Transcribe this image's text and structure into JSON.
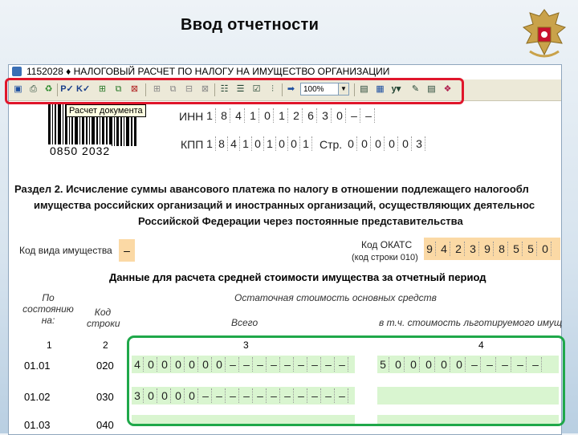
{
  "slide": {
    "title": "Ввод отчетности"
  },
  "window": {
    "title": "1152028 ♦ НАЛОГОВЫЙ РАСЧЕТ ПО НАЛОГУ НА ИМУЩЕСТВО ОРГАНИЗАЦИИ",
    "zoom": "100%"
  },
  "toolbar": {
    "tooltip": "Расчет документа",
    "icons": [
      "save-icon",
      "print-icon",
      "recycle-icon",
      "pv-icon",
      "kv-icon",
      "add-row-icon",
      "copy-row-icon",
      "delete-row-icon",
      "add-doc-icon",
      "copy-doc-icon",
      "edit-doc-icon",
      "delete-doc-icon",
      "calc-icon",
      "list-icon",
      "check-icon",
      "arrow-icon",
      "zoom-select",
      "layout-icon",
      "chart-icon",
      "y-icon",
      "tools-icon",
      "notes-icon",
      "book-icon"
    ]
  },
  "barcode": {
    "number": "0850 2032"
  },
  "header_form": {
    "inn_label": "ИНН",
    "inn_digits": [
      "1",
      "8",
      "4",
      "1",
      "0",
      "1",
      "2",
      "6",
      "3",
      "0",
      "–",
      "–"
    ],
    "kpp_label": "КПП",
    "kpp_digits": [
      "1",
      "8",
      "4",
      "1",
      "0",
      "1",
      "0",
      "0",
      "1"
    ],
    "page_label": "Стр.",
    "page_digits": [
      "0",
      "0",
      "0",
      "0",
      "0",
      "3"
    ]
  },
  "section": {
    "line1": "Раздел 2. Исчисление суммы авансового платежа по налогу в отношении подлежащего налогообл",
    "line2": "имущества российских организаций и иностранных организаций, осуществляющих деятельнос",
    "line3": "Российской Федерации через постоянные представительства"
  },
  "property": {
    "kind_label": "Код вида имущества",
    "kind_value": "–",
    "okato_label": "Код ОКАТС",
    "okato_sublabel": "(код строки 010)",
    "okato_digits": [
      "9",
      "4",
      "2",
      "3",
      "9",
      "8",
      "5",
      "5",
      "0"
    ]
  },
  "table": {
    "title": "Данные для расчета средней стоимости имущества за отчетный период",
    "col1_header": "По состоянию на:",
    "col2_header": "Код строки",
    "group_header": "Остаточная стоимость основных средств",
    "col3_header": "Всего",
    "col4_header": "в т.ч. стоимость льготируемого имущ",
    "col_numbers": [
      "1",
      "2",
      "3",
      "4"
    ],
    "rows": [
      {
        "date": "01.01",
        "code": "020",
        "total": [
          "4",
          "0",
          "0",
          "0",
          "0",
          "0",
          "0",
          "–",
          "–",
          "–",
          "–",
          "–",
          "–",
          "–",
          "–",
          "–"
        ],
        "benefit": [
          "5",
          "0",
          "0",
          "0",
          "0",
          "0",
          "–",
          "–",
          "–",
          "–",
          "–"
        ]
      },
      {
        "date": "01.02",
        "code": "030",
        "total": [
          "3",
          "0",
          "0",
          "0",
          "0",
          "–",
          "–",
          "–",
          "–",
          "–",
          "–",
          "–",
          "–",
          "–",
          "–",
          "–"
        ],
        "benefit": []
      },
      {
        "date": "01.03",
        "code": "040",
        "total": [],
        "benefit": []
      }
    ]
  }
}
